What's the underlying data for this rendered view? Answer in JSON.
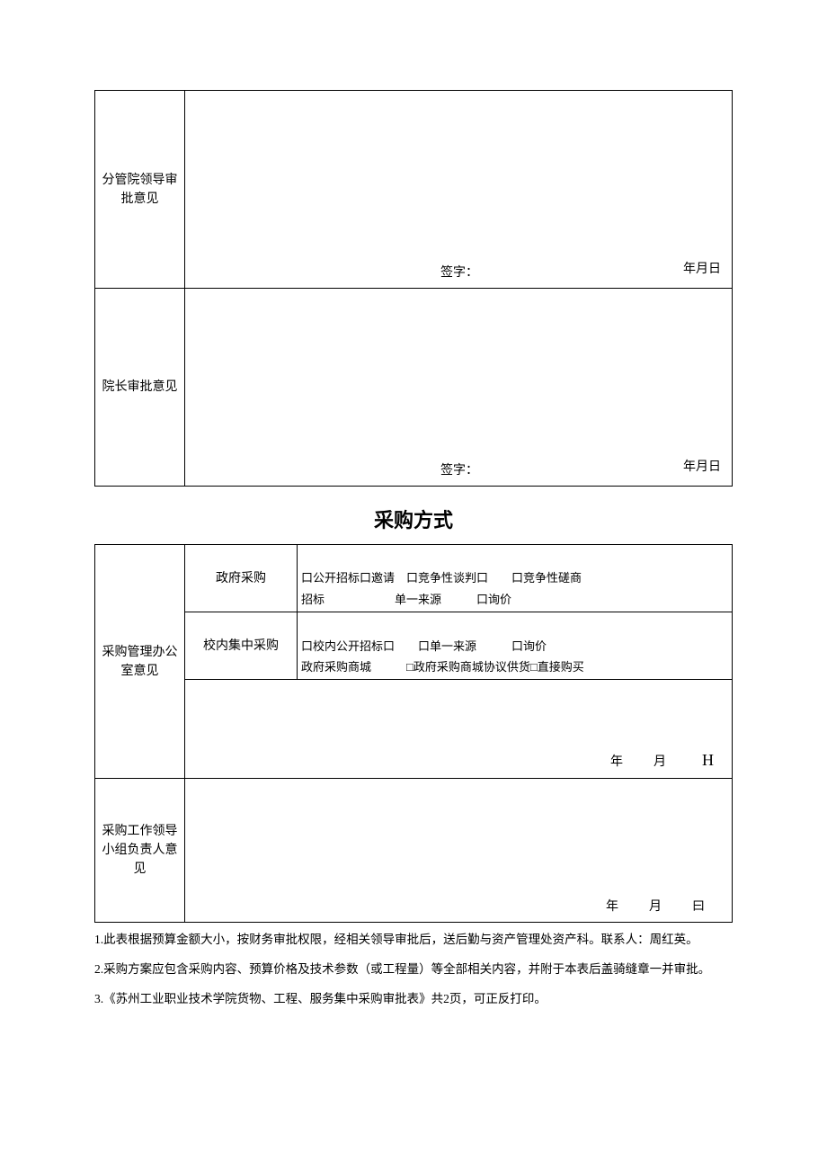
{
  "table1": {
    "row1": {
      "label": "分管院领导审批意见",
      "sign_prefix": "签字：",
      "date": "年月日"
    },
    "row2": {
      "label": "院长审批意见",
      "sign_prefix": "签字：",
      "date": "年月日"
    }
  },
  "title": "采购方式",
  "table2": {
    "mgmt_label": "采购管理办公室意见",
    "gov_label": "政府采购",
    "gov_options": "口公开招标口邀请 口竞争性谈判口  口竞争性磋商\n招标      单一来源   口询价",
    "school_label": "校内集中采购",
    "school_options": "口校内公开招标口  口单一来源   口询价\n政府采购商城   □政府采购商城协议供货□直接购买",
    "mgmt_date": "年 月 ",
    "mgmt_date_suffix": "H",
    "leader_label": "采购工作领导小组负责人意见",
    "leader_date": "年 月 曰"
  },
  "notes": {
    "n1": "1.此表根据预算金额大小，按财务审批权限，经相关领导审批后，送后勤与资产管理处资产科。联系人：周红英。",
    "n2": "2.采购方案应包含采购内容、预算价格及技术参数（或工程量）等全部相关内容，并附于本表后盖骑缝章一并审批。",
    "n3": "3.《苏州工业职业技术学院货物、工程、服务集中采购审批表》共2页，可正反打印。"
  }
}
